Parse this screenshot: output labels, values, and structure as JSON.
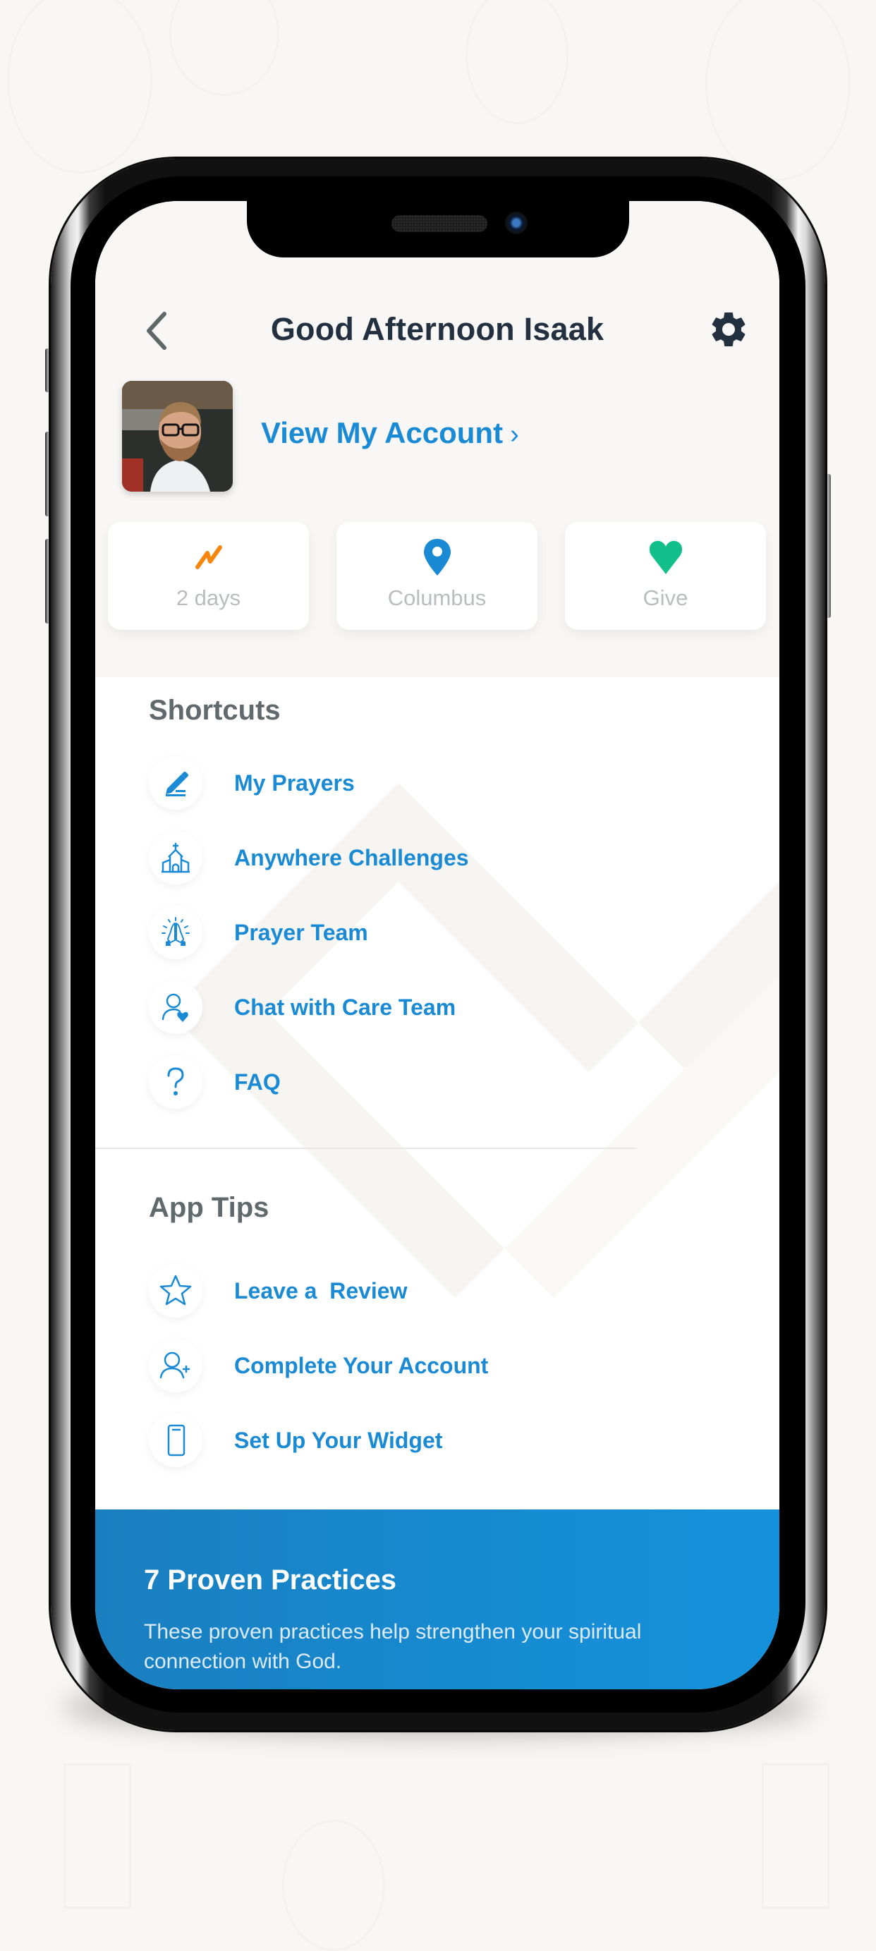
{
  "header": {
    "title": "Good Afternoon Isaak",
    "back_icon": "chevron-left-icon",
    "settings_icon": "gear-icon"
  },
  "profile": {
    "avatar_alt": "profile photo",
    "account_link": "View My Account",
    "account_chevron": "›"
  },
  "stats": [
    {
      "icon": "streak-icon",
      "label": "2 days",
      "color": "#f5870f"
    },
    {
      "icon": "location-pin-icon",
      "label": "Columbus",
      "color": "#1a8ad4"
    },
    {
      "icon": "heart-icon",
      "label": "Give",
      "color": "#12bf8b"
    }
  ],
  "shortcuts": {
    "title": "Shortcuts",
    "items": [
      {
        "icon": "pencil-icon",
        "label": "My Prayers"
      },
      {
        "icon": "church-icon",
        "label": "Anywhere Challenges"
      },
      {
        "icon": "praying-hands-icon",
        "label": "Prayer Team"
      },
      {
        "icon": "person-heart-icon",
        "label": "Chat with Care Team"
      },
      {
        "icon": "question-icon",
        "label": "FAQ"
      }
    ]
  },
  "app_tips": {
    "title": "App Tips",
    "items": [
      {
        "icon": "star-icon",
        "label": "Leave a  Review"
      },
      {
        "icon": "add-person-icon",
        "label": "Complete Your Account"
      },
      {
        "icon": "phone-widget-icon",
        "label": "Set Up Your Widget"
      }
    ]
  },
  "banner": {
    "title": "7 Proven Practices",
    "body": "These proven practices help strengthen your spiritual connection with God."
  },
  "colors": {
    "accent": "#1a8ad4",
    "title": "#22303f",
    "section_title": "#606a6d",
    "streak": "#f5870f",
    "give": "#12bf8b",
    "banner": "#168bd2"
  }
}
